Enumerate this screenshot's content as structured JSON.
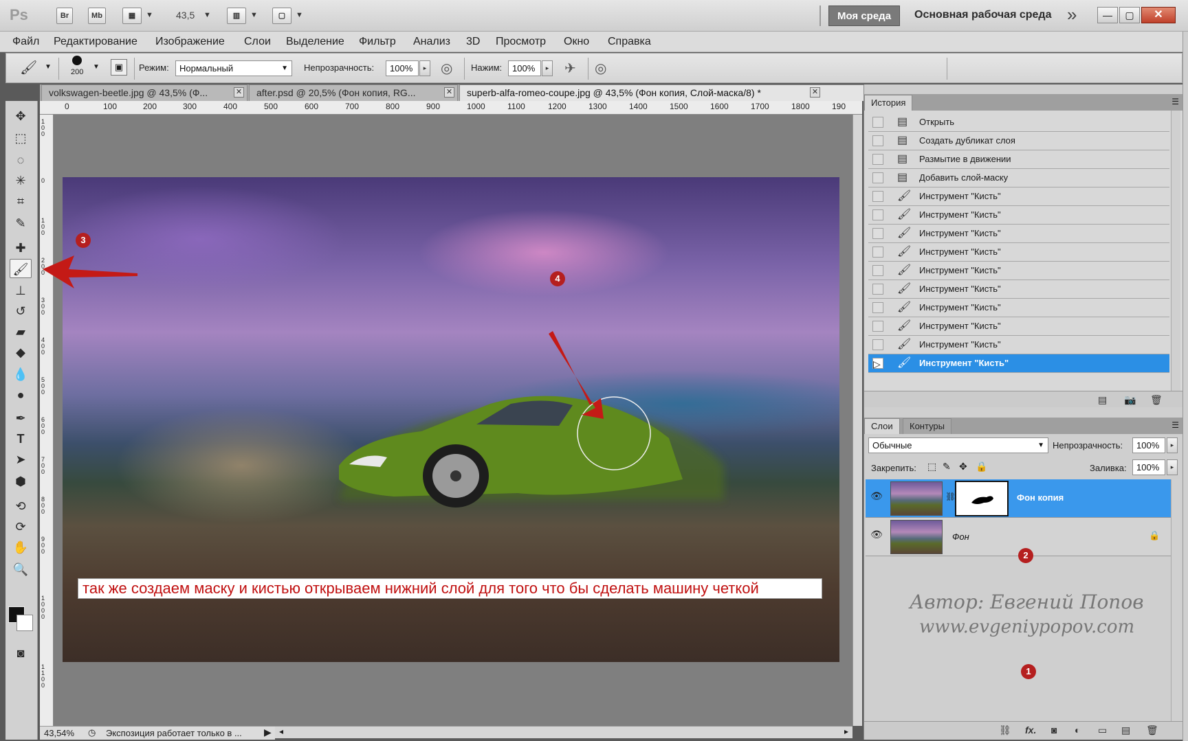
{
  "appbar": {
    "ps_logo": "Ps",
    "br": "Br",
    "mb": "Mb",
    "zoom_value": "43,5",
    "workspace_button": "Моя среда",
    "workspace_label": "Основная рабочая среда",
    "more": "»"
  },
  "menu": [
    "Файл",
    "Редактирование",
    "Изображение",
    "Слои",
    "Выделение",
    "Фильтр",
    "Анализ",
    "3D",
    "Просмотр",
    "Окно",
    "Справка"
  ],
  "options": {
    "brush_size": "200",
    "mode_label": "Режим:",
    "mode_value": "Нормальный",
    "opacity_label": "Непрозрачность:",
    "opacity_value": "100%",
    "flow_label": "Нажим:",
    "flow_value": "100%"
  },
  "tabs": [
    {
      "label": "volkswagen-beetle.jpg @ 43,5% (Ф..."
    },
    {
      "label": "after.psd @ 20,5% (Фон копия, RG..."
    },
    {
      "label": "superb-alfa-romeo-coupe.jpg @ 43,5% (Фон копия, Слой-маска/8) *"
    }
  ],
  "ruler": {
    "h_ticks": [
      "0",
      "100",
      "200",
      "300",
      "400",
      "500",
      "600",
      "700",
      "800",
      "900",
      "1000",
      "1100",
      "1200",
      "1300",
      "1400",
      "1500",
      "1600",
      "1700",
      "1800",
      "190"
    ],
    "v_ticks": [
      "100",
      "0",
      "100",
      "200",
      "300",
      "400",
      "500",
      "600",
      "700",
      "800",
      "900",
      "1000",
      "1100"
    ]
  },
  "canvas": {
    "caption": "так же создаем маску и кистью открываем нижний слой для того что бы сделать машину четкой"
  },
  "status": {
    "zoom": "43,54%",
    "message": "Экспозиция работает только в ..."
  },
  "history": {
    "tab": "История",
    "items": [
      {
        "label": "Открыть",
        "icon": "document-icon"
      },
      {
        "label": "Создать дубликат слоя",
        "icon": "document-icon"
      },
      {
        "label": "Размытие в движении",
        "icon": "document-icon"
      },
      {
        "label": "Добавить слой-маску",
        "icon": "document-icon"
      },
      {
        "label": "Инструмент \"Кисть\"",
        "icon": "brush-icon"
      },
      {
        "label": "Инструмент \"Кисть\"",
        "icon": "brush-icon"
      },
      {
        "label": "Инструмент \"Кисть\"",
        "icon": "brush-icon"
      },
      {
        "label": "Инструмент \"Кисть\"",
        "icon": "brush-icon"
      },
      {
        "label": "Инструмент \"Кисть\"",
        "icon": "brush-icon"
      },
      {
        "label": "Инструмент \"Кисть\"",
        "icon": "brush-icon"
      },
      {
        "label": "Инструмент \"Кисть\"",
        "icon": "brush-icon"
      },
      {
        "label": "Инструмент \"Кисть\"",
        "icon": "brush-icon"
      },
      {
        "label": "Инструмент \"Кисть\"",
        "icon": "brush-icon"
      },
      {
        "label": "Инструмент \"Кисть\"",
        "icon": "brush-icon",
        "selected": true
      }
    ]
  },
  "layers": {
    "tab_layers": "Слои",
    "tab_paths": "Контуры",
    "blend_mode": "Обычные",
    "opacity_label": "Непрозрачность:",
    "opacity_value": "100%",
    "lock_label": "Закрепить:",
    "fill_label": "Заливка:",
    "fill_value": "100%",
    "items": [
      {
        "name": "Фон копия",
        "selected": true
      },
      {
        "name": "Фон",
        "locked": true
      }
    ]
  },
  "watermark": {
    "line1": "Автор: Евгений Попов",
    "line2": "www.evgeniypopov.com"
  },
  "annotations": [
    "1",
    "2",
    "3",
    "4"
  ],
  "colors": {
    "accent": "#2b8fe5",
    "annotation_red": "#b51f1f",
    "caption_text": "#c01010"
  }
}
